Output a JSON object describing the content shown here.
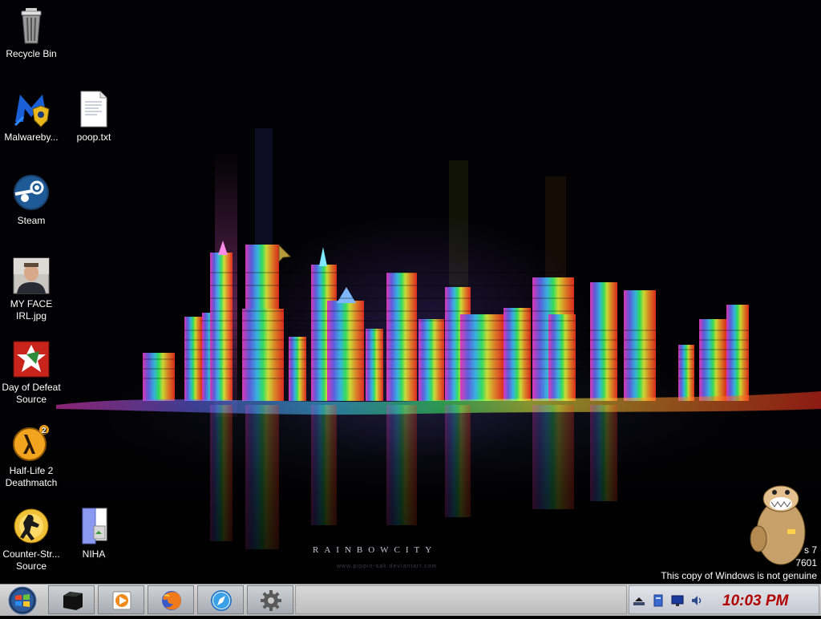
{
  "desktop": {
    "icons": [
      {
        "label": "Recycle Bin"
      },
      {
        "label": "Malwareby..."
      },
      {
        "label": "poop.txt"
      },
      {
        "label": "Steam"
      },
      {
        "label": "MY FACE IRL.jpg"
      },
      {
        "label": "Day of Defeat Source"
      },
      {
        "label": "Half-Life 2 Deathmatch"
      },
      {
        "label": "Counter-Str... Source"
      },
      {
        "label": "NIHA"
      }
    ],
    "wallpaper_caption": "RAINBOWCITY",
    "wallpaper_subcaption": "www.pippin-sak.deviantart.com",
    "watermark": {
      "line1": "s 7",
      "line2": "7601",
      "line3": "This copy of Windows is not genuine"
    }
  },
  "taskbar": {
    "start": "start-orb-icon",
    "buttons": [
      {
        "icon": "black-box-icon"
      },
      {
        "icon": "media-player-icon"
      },
      {
        "icon": "firefox-icon"
      },
      {
        "icon": "safari-compass-icon"
      },
      {
        "icon": "gear-icon"
      }
    ],
    "tray": [
      "show-hidden-icons-arrow",
      "network-drive-icon",
      "monitor-icon",
      "volume-icon"
    ],
    "clock": "10:03 PM"
  },
  "colors": {
    "clock": "#b00000",
    "taskbar": "#c4c4c4"
  }
}
